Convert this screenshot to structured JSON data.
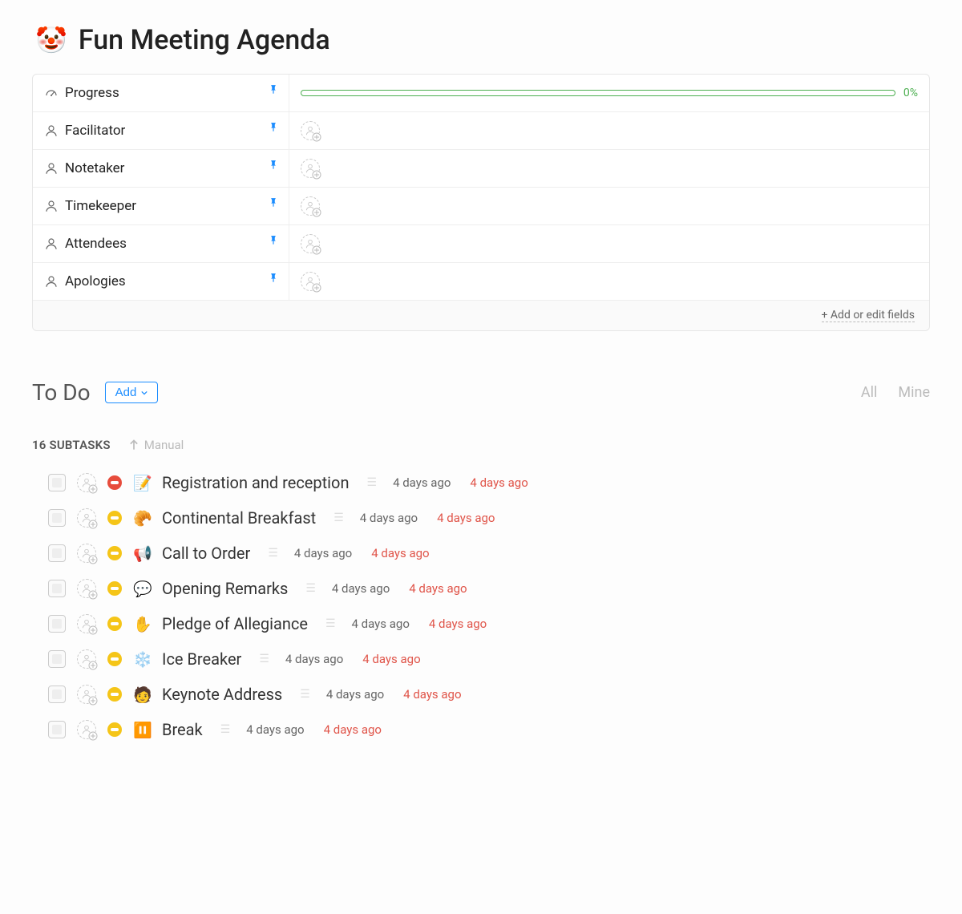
{
  "page": {
    "emoji": "🤡",
    "title": "Fun Meeting Agenda"
  },
  "fields": [
    {
      "icon": "speed",
      "label": "Progress",
      "type": "progress",
      "pinned": true,
      "progress_percent": 0,
      "progress_text": "0%"
    },
    {
      "icon": "person",
      "label": "Facilitator",
      "type": "person",
      "pinned": true
    },
    {
      "icon": "person",
      "label": "Notetaker",
      "type": "person",
      "pinned": true
    },
    {
      "icon": "person",
      "label": "Timekeeper",
      "type": "person",
      "pinned": true
    },
    {
      "icon": "person",
      "label": "Attendees",
      "type": "person",
      "pinned": true
    },
    {
      "icon": "person",
      "label": "Apologies",
      "type": "person",
      "pinned": true
    }
  ],
  "fields_footer": {
    "add_edit_label": "+ Add or edit fields"
  },
  "todo": {
    "title": "To Do",
    "add_label": "Add",
    "filters": {
      "all": "All",
      "mine": "Mine"
    },
    "subtasks_count_label": "16 SUBTASKS",
    "sort_label": "Manual"
  },
  "tasks": [
    {
      "status": "red",
      "emoji": "📝",
      "title": "Registration and reception",
      "date1": "4 days ago",
      "date2": "4 days ago"
    },
    {
      "status": "yellow",
      "emoji": "🥐",
      "title": "Continental Breakfast",
      "date1": "4 days ago",
      "date2": "4 days ago"
    },
    {
      "status": "yellow",
      "emoji": "📢",
      "title": "Call to Order",
      "date1": "4 days ago",
      "date2": "4 days ago"
    },
    {
      "status": "yellow",
      "emoji": "💬",
      "title": "Opening Remarks",
      "date1": "4 days ago",
      "date2": "4 days ago"
    },
    {
      "status": "yellow",
      "emoji": "✋",
      "title": "Pledge of Allegiance",
      "date1": "4 days ago",
      "date2": "4 days ago"
    },
    {
      "status": "yellow",
      "emoji": "❄️",
      "title": "Ice Breaker",
      "date1": "4 days ago",
      "date2": "4 days ago"
    },
    {
      "status": "yellow",
      "emoji": "🧑",
      "title": "Keynote Address",
      "date1": "4 days ago",
      "date2": "4 days ago"
    },
    {
      "status": "yellow",
      "emoji": "⏸️",
      "title": "Break",
      "date1": "4 days ago",
      "date2": "4 days ago"
    }
  ]
}
